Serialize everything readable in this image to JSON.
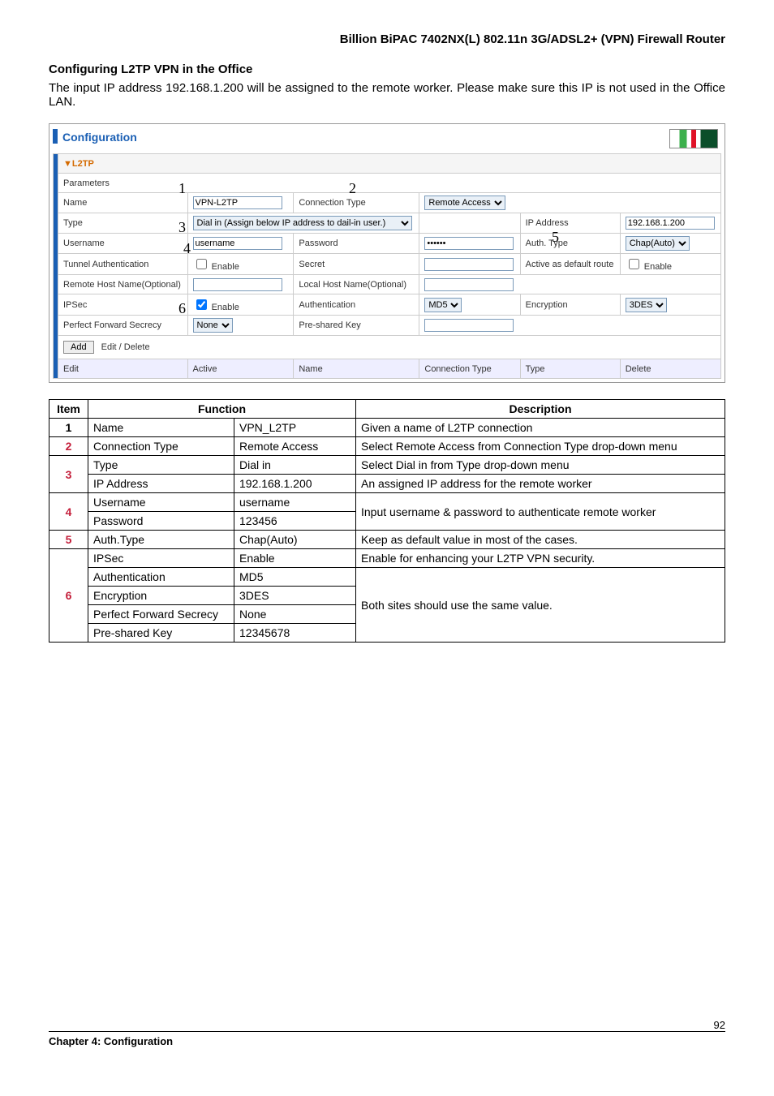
{
  "header_title": "Billion BiPAC 7402NX(L) 802.11n 3G/ADSL2+ (VPN) Firewall Router",
  "section_title": "Configuring L2TP VPN in the Office",
  "intro": "The input IP address 192.168.1.200 will be assigned to the remote worker. Please make sure this IP is not used in the Office LAN.",
  "config": {
    "panel_title": "Configuration",
    "group": "▼L2TP",
    "parameters_label": "Parameters",
    "rows": {
      "name_label": "Name",
      "name_value": "VPN-L2TP",
      "conn_type_label": "Connection Type",
      "conn_type_value": "Remote Access",
      "type_label": "Type",
      "type_value": "Dial in (Assign below IP address to dail-in user.)",
      "ip_label": "IP Address",
      "ip_value": "192.168.1.200",
      "user_label": "Username",
      "user_value": "username",
      "pass_label": "Password",
      "pass_value": "••••••",
      "auth_type_label": "Auth. Type",
      "auth_type_value": "Chap(Auto)",
      "tunnel_auth_label": "Tunnel Authentication",
      "tunnel_auth_check": "Enable",
      "secret_label": "Secret",
      "active_default_label": "Active as default route",
      "active_default_check": "Enable",
      "remote_host_label": "Remote Host Name(Optional)",
      "local_host_label": "Local Host Name(Optional)",
      "ipsec_label": "IPSec",
      "ipsec_check": "Enable",
      "authn_label": "Authentication",
      "authn_value": "MD5",
      "enc_label": "Encryption",
      "enc_value": "3DES",
      "pfs_label": "Perfect Forward Secrecy",
      "pfs_value": "None",
      "psk_label": "Pre-shared Key"
    },
    "add_btn": "Add",
    "edit_delete": "Edit / Delete",
    "grid_header": {
      "edit": "Edit",
      "active": "Active",
      "name": "Name",
      "conn": "Connection Type",
      "type": "Type",
      "delete": "Delete"
    }
  },
  "overlay_numbers": {
    "n1": "1",
    "n2": "2",
    "n3": "3",
    "n4": "4",
    "n5": "5",
    "n6": "6"
  },
  "desc": {
    "h_item": "Item",
    "h_func": "Function",
    "h_desc": "Description",
    "rows": [
      {
        "n": "1",
        "color": "black",
        "func": "Name",
        "val": "VPN_L2TP",
        "desc": "Given a name of L2TP connection"
      },
      {
        "n": "2",
        "color": "red",
        "func": "Connection Type",
        "val": "Remote Access",
        "desc": "Select Remote Access from Connection Type drop-down menu"
      },
      {
        "n": "3",
        "color": "red",
        "group": [
          {
            "func": "Type",
            "val": "Dial in",
            "desc": "Select Dial in from Type drop-down menu"
          },
          {
            "func": "IP Address",
            "val": "192.168.1.200",
            "desc": "An assigned IP address for the remote worker"
          }
        ]
      },
      {
        "n": "4",
        "color": "red",
        "group": [
          {
            "func": "Username",
            "val": "username"
          },
          {
            "func": "Password",
            "val": "123456"
          }
        ],
        "merged_desc": "Input username & password to authenticate remote worker"
      },
      {
        "n": "5",
        "color": "red",
        "func": "Auth.Type",
        "val": "Chap(Auto)",
        "desc": "Keep as default value in most of the cases."
      },
      {
        "n": "6",
        "color": "red",
        "group": [
          {
            "func": "IPSec",
            "val": "Enable",
            "desc": "Enable for enhancing your L2TP VPN security."
          },
          {
            "func": "Authentication",
            "val": "MD5"
          },
          {
            "func": "Encryption",
            "val": "3DES"
          },
          {
            "func": "Perfect Forward Secrecy",
            "val": "None"
          },
          {
            "func": "Pre-shared Key",
            "val": "12345678"
          }
        ],
        "merged_desc": "Both sites should use the same value."
      }
    ]
  },
  "footer": {
    "chapter": "Chapter 4: Configuration",
    "page": "92"
  }
}
